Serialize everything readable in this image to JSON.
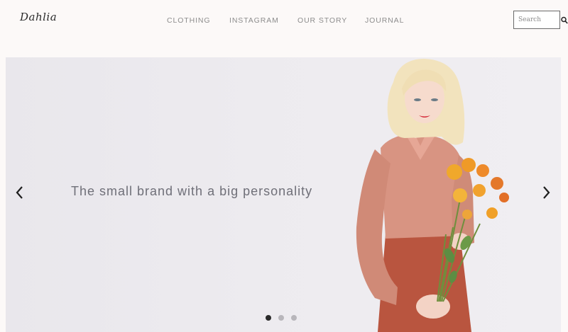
{
  "header": {
    "logo_text": "Dahlia",
    "nav": [
      {
        "label": "CLOTHING"
      },
      {
        "label": "INSTAGRAM"
      },
      {
        "label": "OUR STORY"
      },
      {
        "label": "JOURNAL"
      }
    ],
    "search": {
      "placeholder": "Search",
      "value": "",
      "icon": "search-icon"
    }
  },
  "hero": {
    "tagline": "The small brand with a big personality",
    "prev_icon": "chevron-left-icon",
    "next_icon": "chevron-right-icon",
    "slides_total": 3,
    "active_slide": 1,
    "image": "model-with-flowers-photo"
  },
  "colors": {
    "header_bg": "#fcf9f8",
    "nav_text": "#8d8d8d",
    "hero_bg": "#edebef",
    "tagline_text": "#6f6f78",
    "dot_active": "#2a2a2a",
    "dot_inactive": "#b8b6bb"
  }
}
